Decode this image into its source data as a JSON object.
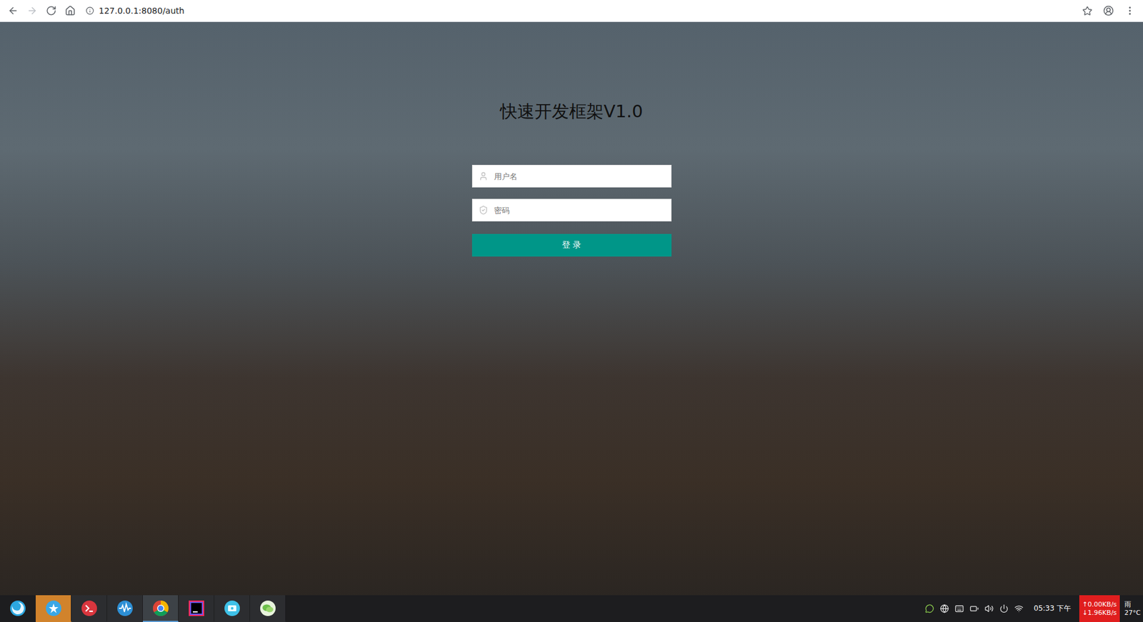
{
  "browser": {
    "nav_buttons": [
      {
        "kind": "back",
        "disabled": false
      },
      {
        "kind": "forward",
        "disabled": true
      },
      {
        "kind": "reload",
        "disabled": false
      },
      {
        "kind": "home",
        "disabled": false
      }
    ],
    "url": "127.0.0.1:8080/auth"
  },
  "login": {
    "title": "快速开发框架V1.0",
    "fields": [
      {
        "kind": "user",
        "placeholder": "用户名"
      },
      {
        "kind": "password",
        "placeholder": "密码"
      }
    ],
    "button": "登 录"
  },
  "taskbar": {
    "apps": [
      {
        "kind": "launcher",
        "selected": false,
        "hovered": false
      },
      {
        "kind": "appstore",
        "selected": false,
        "hovered": true
      },
      {
        "kind": "terminal",
        "selected": false,
        "hovered": false
      },
      {
        "kind": "monitor",
        "selected": false,
        "hovered": false
      },
      {
        "kind": "chrome",
        "selected": true,
        "hovered": false
      },
      {
        "kind": "intellij",
        "selected": false,
        "hovered": false
      },
      {
        "kind": "files",
        "selected": false,
        "hovered": false
      },
      {
        "kind": "chat",
        "selected": false,
        "hovered": false
      }
    ],
    "tray": [
      {
        "kind": "wechat"
      },
      {
        "kind": "globe"
      },
      {
        "kind": "keyboard"
      },
      {
        "kind": "battery"
      },
      {
        "kind": "volume"
      },
      {
        "kind": "power"
      },
      {
        "kind": "wifi"
      }
    ],
    "clock": "05:33 下午",
    "network": {
      "up": "↑0.00KB/s",
      "down": "↓1.96KB/s"
    },
    "weather": {
      "condition": "雨",
      "temperature": "27°C"
    }
  }
}
